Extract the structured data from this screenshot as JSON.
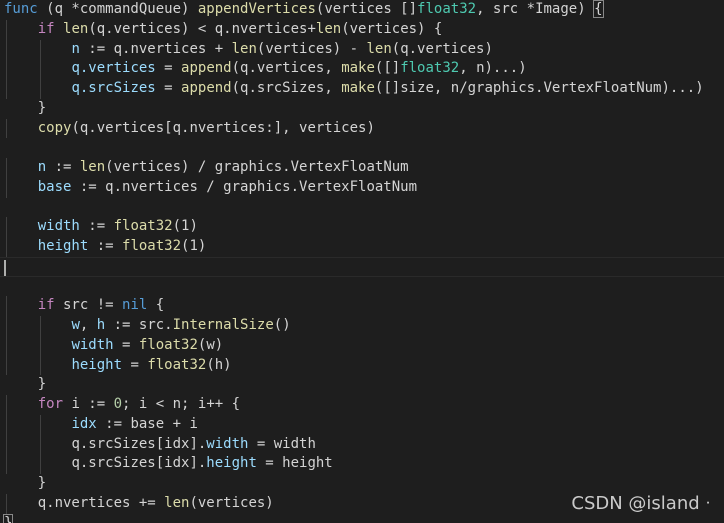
{
  "editor": {
    "lines": [
      [
        {
          "t": "func",
          "c": "tok-kw"
        },
        {
          "t": " (q *commandQueue) ",
          "c": "tok-plain"
        },
        {
          "t": "appendVertices",
          "c": "tok-fn"
        },
        {
          "t": "(vertices []",
          "c": "tok-plain"
        },
        {
          "t": "float32",
          "c": "tok-type"
        },
        {
          "t": ", src *Image) ",
          "c": "tok-plain"
        },
        {
          "t": "{",
          "c": "tok-plain",
          "box": true
        }
      ],
      [
        {
          "t": "    ",
          "c": "tok-plain"
        },
        {
          "t": "if",
          "c": "tok-ctrl"
        },
        {
          "t": " ",
          "c": "tok-plain"
        },
        {
          "t": "len",
          "c": "tok-fn"
        },
        {
          "t": "(q.vertices) < q.nvertices+",
          "c": "tok-plain"
        },
        {
          "t": "len",
          "c": "tok-fn"
        },
        {
          "t": "(vertices) {",
          "c": "tok-plain"
        }
      ],
      [
        {
          "t": "        ",
          "c": "tok-plain"
        },
        {
          "t": "n",
          "c": "tok-var"
        },
        {
          "t": " := q.nvertices + ",
          "c": "tok-plain"
        },
        {
          "t": "len",
          "c": "tok-fn"
        },
        {
          "t": "(vertices) - ",
          "c": "tok-plain"
        },
        {
          "t": "len",
          "c": "tok-fn"
        },
        {
          "t": "(q.vertices)",
          "c": "tok-plain"
        }
      ],
      [
        {
          "t": "        ",
          "c": "tok-plain"
        },
        {
          "t": "q.",
          "c": "tok-var"
        },
        {
          "t": "vertices",
          "c": "tok-var"
        },
        {
          "t": " = ",
          "c": "tok-plain"
        },
        {
          "t": "append",
          "c": "tok-fn"
        },
        {
          "t": "(q.vertices, ",
          "c": "tok-plain"
        },
        {
          "t": "make",
          "c": "tok-fn"
        },
        {
          "t": "([]",
          "c": "tok-plain"
        },
        {
          "t": "float32",
          "c": "tok-type"
        },
        {
          "t": ", n)...)",
          "c": "tok-plain"
        }
      ],
      [
        {
          "t": "        ",
          "c": "tok-plain"
        },
        {
          "t": "q.",
          "c": "tok-var"
        },
        {
          "t": "srcSizes",
          "c": "tok-var"
        },
        {
          "t": " = ",
          "c": "tok-plain"
        },
        {
          "t": "append",
          "c": "tok-fn"
        },
        {
          "t": "(q.srcSizes, ",
          "c": "tok-plain"
        },
        {
          "t": "make",
          "c": "tok-fn"
        },
        {
          "t": "([]size, n/graphics.VertexFloatNum)...)",
          "c": "tok-plain"
        }
      ],
      [
        {
          "t": "    }",
          "c": "tok-plain"
        }
      ],
      [
        {
          "t": "    ",
          "c": "tok-plain"
        },
        {
          "t": "copy",
          "c": "tok-fn"
        },
        {
          "t": "(q.vertices[q.nvertices:], vertices)",
          "c": "tok-plain"
        }
      ],
      [],
      [
        {
          "t": "    ",
          "c": "tok-plain"
        },
        {
          "t": "n",
          "c": "tok-var"
        },
        {
          "t": " := ",
          "c": "tok-plain"
        },
        {
          "t": "len",
          "c": "tok-fn"
        },
        {
          "t": "(vertices) / graphics.VertexFloatNum",
          "c": "tok-plain"
        }
      ],
      [
        {
          "t": "    ",
          "c": "tok-plain"
        },
        {
          "t": "base",
          "c": "tok-var"
        },
        {
          "t": " := q.nvertices / graphics.VertexFloatNum",
          "c": "tok-plain"
        }
      ],
      [],
      [
        {
          "t": "    ",
          "c": "tok-plain"
        },
        {
          "t": "width",
          "c": "tok-var"
        },
        {
          "t": " := ",
          "c": "tok-plain"
        },
        {
          "t": "float32",
          "c": "tok-fn"
        },
        {
          "t": "(1)",
          "c": "tok-plain"
        }
      ],
      [
        {
          "t": "    ",
          "c": "tok-plain"
        },
        {
          "t": "height",
          "c": "tok-var"
        },
        {
          "t": " := ",
          "c": "tok-plain"
        },
        {
          "t": "float32",
          "c": "tok-fn"
        },
        {
          "t": "(1)",
          "c": "tok-plain"
        }
      ],
      [],
      [],
      [
        {
          "t": "    ",
          "c": "tok-plain"
        },
        {
          "t": "if",
          "c": "tok-ctrl"
        },
        {
          "t": " src != ",
          "c": "tok-plain"
        },
        {
          "t": "nil",
          "c": "tok-nil"
        },
        {
          "t": " {",
          "c": "tok-plain"
        }
      ],
      [
        {
          "t": "        ",
          "c": "tok-plain"
        },
        {
          "t": "w",
          "c": "tok-var"
        },
        {
          "t": ", ",
          "c": "tok-plain"
        },
        {
          "t": "h",
          "c": "tok-var"
        },
        {
          "t": " := src.",
          "c": "tok-plain"
        },
        {
          "t": "InternalSize",
          "c": "tok-fn"
        },
        {
          "t": "()",
          "c": "tok-plain"
        }
      ],
      [
        {
          "t": "        ",
          "c": "tok-plain"
        },
        {
          "t": "width",
          "c": "tok-var"
        },
        {
          "t": " = ",
          "c": "tok-plain"
        },
        {
          "t": "float32",
          "c": "tok-fn"
        },
        {
          "t": "(w)",
          "c": "tok-plain"
        }
      ],
      [
        {
          "t": "        ",
          "c": "tok-plain"
        },
        {
          "t": "height",
          "c": "tok-var"
        },
        {
          "t": " = ",
          "c": "tok-plain"
        },
        {
          "t": "float32",
          "c": "tok-fn"
        },
        {
          "t": "(h)",
          "c": "tok-plain"
        }
      ],
      [
        {
          "t": "    }",
          "c": "tok-plain"
        }
      ],
      [
        {
          "t": "    ",
          "c": "tok-plain"
        },
        {
          "t": "for",
          "c": "tok-ctrl"
        },
        {
          "t": " i := ",
          "c": "tok-plain"
        },
        {
          "t": "0",
          "c": "tok-num"
        },
        {
          "t": "; i < n; i++ {",
          "c": "tok-plain"
        }
      ],
      [
        {
          "t": "        ",
          "c": "tok-plain"
        },
        {
          "t": "idx",
          "c": "tok-var"
        },
        {
          "t": " := base + i",
          "c": "tok-plain"
        }
      ],
      [
        {
          "t": "        ",
          "c": "tok-plain"
        },
        {
          "t": "q.srcSizes[idx].",
          "c": "tok-plain"
        },
        {
          "t": "width",
          "c": "tok-var"
        },
        {
          "t": " = width",
          "c": "tok-plain"
        }
      ],
      [
        {
          "t": "        ",
          "c": "tok-plain"
        },
        {
          "t": "q.srcSizes[idx].",
          "c": "tok-plain"
        },
        {
          "t": "height",
          "c": "tok-var"
        },
        {
          "t": " = height",
          "c": "tok-plain"
        }
      ],
      [
        {
          "t": "    }",
          "c": "tok-plain"
        }
      ],
      [
        {
          "t": "    ",
          "c": "tok-plain"
        },
        {
          "t": "q.nvertices += ",
          "c": "tok-plain"
        },
        {
          "t": "len",
          "c": "tok-fn"
        },
        {
          "t": "(vertices)",
          "c": "tok-plain"
        }
      ],
      [
        {
          "t": "}",
          "c": "tok-plain",
          "box": true
        }
      ]
    ],
    "current_line_index": 13
  },
  "watermark": {
    "text": "CSDN @island ᐧ"
  },
  "colors": {
    "background": "#1e1e1e",
    "keyword": "#569cd6",
    "control": "#c586c0",
    "function": "#dcdcaa",
    "type": "#4ec9b0",
    "variable": "#9cdcfe",
    "number": "#b5cea8",
    "text": "#d4d4d4"
  }
}
